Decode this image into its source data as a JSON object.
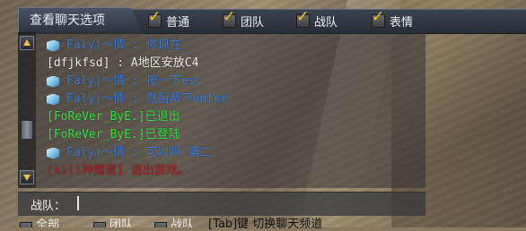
{
  "header": {
    "title": "查看聊天选项",
    "options": [
      {
        "label": "普通",
        "checked": true
      },
      {
        "label": "团队",
        "checked": true
      },
      {
        "label": "战队",
        "checked": true
      },
      {
        "label": "表情",
        "checked": true
      }
    ]
  },
  "messages": [
    {
      "icon": "team-badge-icon",
      "color": "blue",
      "text": "Faly|～情 : 你现在"
    },
    {
      "icon": null,
      "color": "white",
      "text": "[dfjkfsd] : A地区安放C4"
    },
    {
      "icon": "team-badge-icon",
      "color": "blue",
      "text": "Faly|～情 : 按一下esc"
    },
    {
      "icon": "team-badge-icon",
      "color": "blue",
      "text": "Faly|～情 : 然后两下enter"
    },
    {
      "icon": null,
      "color": "green",
      "text": "[FoReVer_ByE.]已退出"
    },
    {
      "icon": null,
      "color": "green",
      "text": "[FoReVer_ByE.]已登陆"
    },
    {
      "icon": "team-badge-icon",
      "color": "blue",
      "text": "Faly|～情 : 可以吗 第二"
    },
    {
      "icon": null,
      "color": "red",
      "text": "[kill神魔意] 退出游戏。"
    }
  ],
  "input": {
    "label": "战队：",
    "value": ""
  },
  "bottom": {
    "items": [
      "全部",
      "团队",
      "战队"
    ],
    "hint": "[Tab]键 切换聊天频道"
  },
  "colors": {
    "blue": "#3f7fd6",
    "white": "#f4f4f4",
    "green": "#3ee04a",
    "red": "#a92a2a",
    "accent": "#f0c33a"
  }
}
